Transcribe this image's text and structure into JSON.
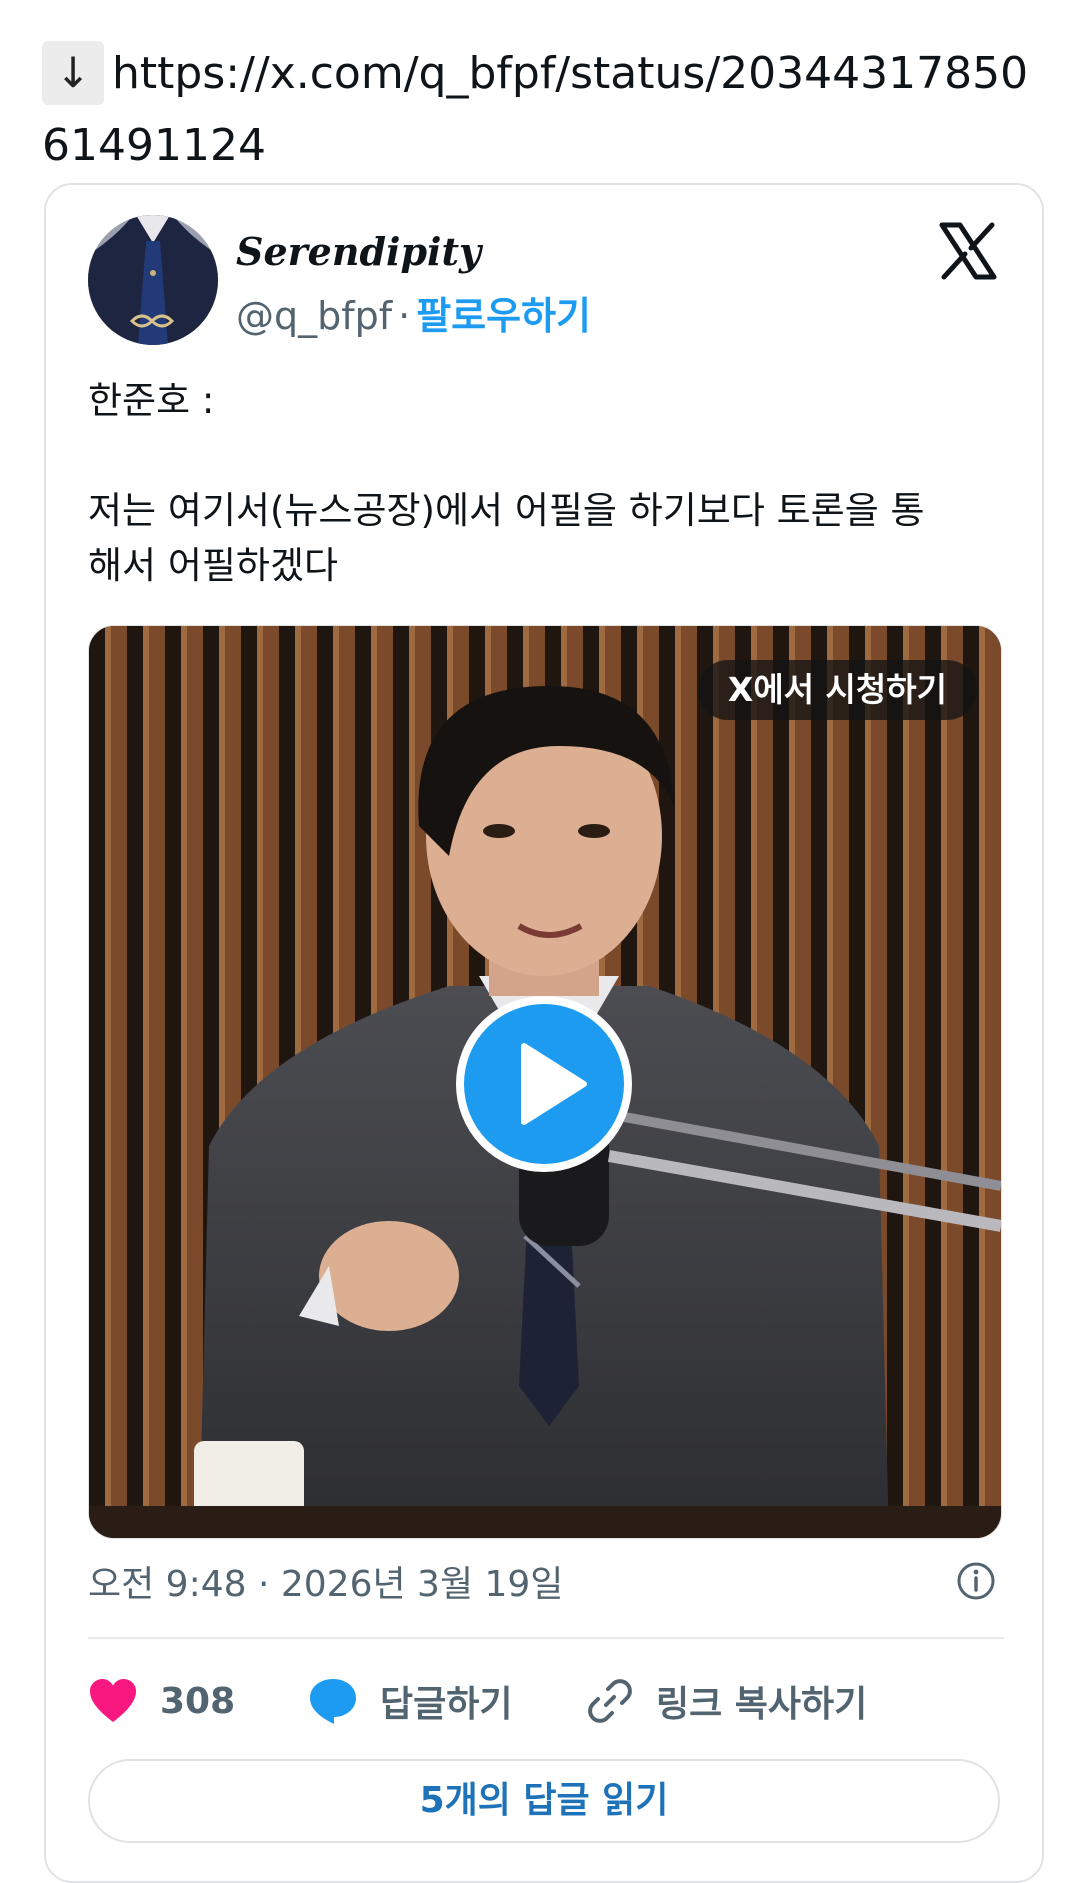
{
  "link": {
    "arrow": "↓",
    "url": "https://x.com/q_bfpf/status/2034431785061491124"
  },
  "tweet": {
    "display_name": "Serendipity",
    "handle": "@q_bfpf",
    "separator": "·",
    "follow_label": "팔로우하기",
    "text": "한준호 :\n\n저는 여기서(뉴스공장)에서 어필을 하기보다 토론을 통\n해서 어필하겠다",
    "watch_label": "X에서 시청하기",
    "timestamp": "오전 9:48 · 2026년 3월 19일",
    "likes": "308",
    "reply_label": "답글하기",
    "copy_link_label": "링크 복사하기",
    "read_replies_label": "5개의 답글 읽기"
  },
  "icons": {
    "link_arrow": "down-arrow-icon",
    "brand": "x-logo-icon",
    "play": "play-icon",
    "info": "info-icon",
    "like": "heart-icon",
    "reply": "speech-bubble-icon",
    "copy": "link-icon"
  },
  "colors": {
    "accent": "#1d9bf0",
    "like": "#f91880",
    "muted": "#536471",
    "replies_text": "#1d72b8"
  }
}
